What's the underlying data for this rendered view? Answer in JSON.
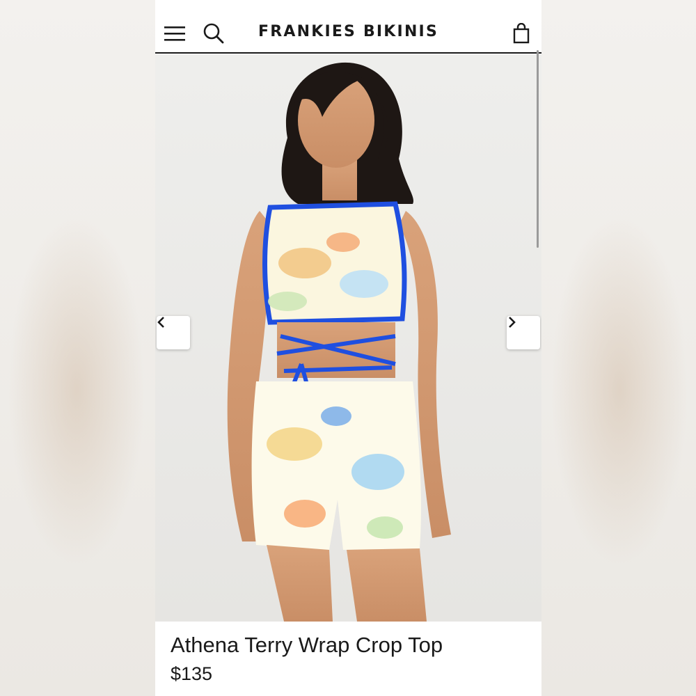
{
  "header": {
    "brand": "FRANKIES BIKINIS",
    "icons": [
      "menu-icon",
      "search-icon",
      "shopping-bag-icon"
    ]
  },
  "gallery": {
    "prev_icon": "chevron-left-icon",
    "next_icon": "chevron-right-icon"
  },
  "product": {
    "name": "Athena Terry Wrap Crop Top",
    "price": "$135"
  },
  "colors": {
    "accent_blue": "#1f4fe0",
    "text": "#1a1a1a",
    "hero_bg": "#eeeeec"
  }
}
